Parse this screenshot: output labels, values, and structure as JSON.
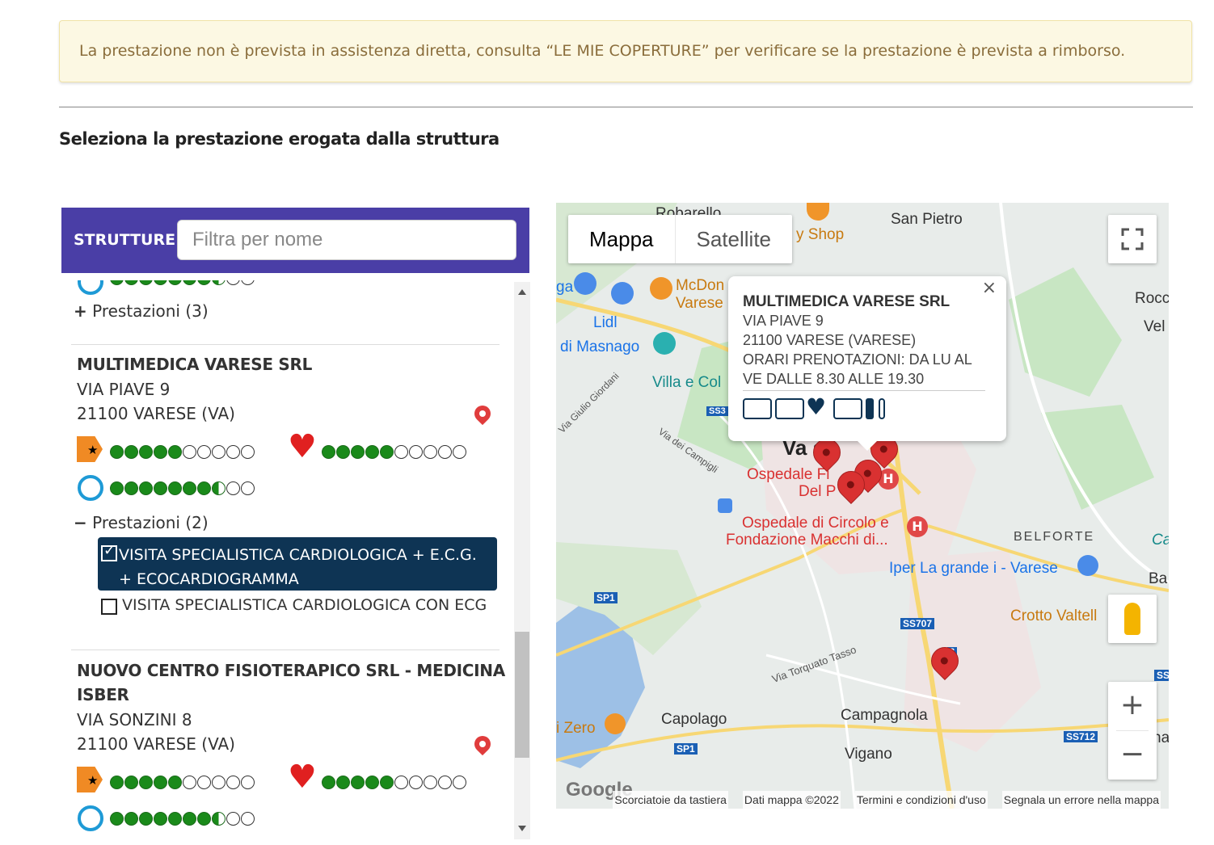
{
  "alert": {
    "text": "La prestazione non è prevista in assistenza diretta, consulta “LE MIE COPERTURE” per verificare se la prestazione è prevista a rimborso."
  },
  "section_title": "Seleziona la prestazione erogata dalla struttura",
  "panel": {
    "header_label": "STRUTTURE",
    "filter_placeholder": "Filtra per nome",
    "prev_prestazioni": "Prestazioni (3)",
    "prev_expand_symbol": "+",
    "structures": [
      {
        "name": "MULTIMEDICA VARESE SRL",
        "address": "VIA PIAVE 9",
        "city": "21100 VARESE (VA)",
        "ratings": {
          "price": 5,
          "satisfaction": 5,
          "time": 7.5
        },
        "prestazioni_label": "Prestazioni (2)",
        "collapse_symbol": "−",
        "services": [
          {
            "label": "VISITA SPECIALISTICA CARDIOLOGICA + E.C.G. + ECOCARDIOGRAMMA",
            "checked": true
          },
          {
            "label": "VISITA SPECIALISTICA CARDIOLOGICA CON ECG",
            "checked": false
          }
        ]
      },
      {
        "name_line1": "NUOVO CENTRO FISIOTERAPICO SRL - MEDICINA",
        "name_line2": "ISBER",
        "address": "VIA SONZINI 8",
        "city": "21100 VARESE (VA)",
        "ratings": {
          "price": 5,
          "satisfaction": 5,
          "time": 7.5
        }
      }
    ]
  },
  "map": {
    "type_buttons": [
      "Mappa",
      "Satellite"
    ],
    "popup": {
      "name": "MULTIMEDICA VARESE SRL",
      "address": "VIA PIAVE 9",
      "city": "21100 VARESE (VARESE)",
      "hours1": "ORARI PRENOTAZIONI: DA LU AL",
      "hours2": "VE DALLE 8.30 ALLE 19.30",
      "close": "×"
    },
    "labels": {
      "roba": "Robarello",
      "sanpietro": "San Pietro",
      "shop": "y Shop",
      "mcdon": "McDon",
      "varese2": "Varese",
      "lidl": "Lidl",
      "masnago": "di Masnago",
      "villa": "Villa e Col",
      "giordani": "Via Giulio Giordani",
      "campigli": "Via dei Campigli",
      "ospedale1": "Ospedale Fi",
      "ospedale1b": "Del P",
      "varese_city": "Va    se",
      "circolo": "Ospedale di Circolo e",
      "macchi": "Fondazione Macchi di...",
      "belforte": "BELFORTE",
      "iper": "Iper La grande i - Varese",
      "crotto": "Crotto Valtell",
      "tasso": "Via Torquato Tasso",
      "campagnola": "Campagnola",
      "capolago": "Capolago",
      "vigano": "Vigano",
      "zero": "i Zero",
      "roc": "Rocc",
      "vel": "Vel",
      "ca": "Ca",
      "ba": "Ba",
      "ga": "ga",
      "ss707": "SS707",
      "ss712": "SS712",
      "sp1a": "SP1",
      "sp1b": "SP1",
      "ss3": "SS3",
      "ss_r": "SS",
      "na": "na",
      "h3": "3",
      "google": "Google"
    },
    "footer": [
      "Scorciatoie da tastiera",
      "Dati mappa ©2022",
      "Termini e condizioni d'uso",
      "Segnala un errore nella mappa"
    ],
    "colors": {
      "land": "#e8ecea",
      "green": "#c8e6c3",
      "water": "#9dc0e6",
      "road_major": "#f7d774",
      "urban": "#efe4e4",
      "pin": "#d93131"
    }
  }
}
